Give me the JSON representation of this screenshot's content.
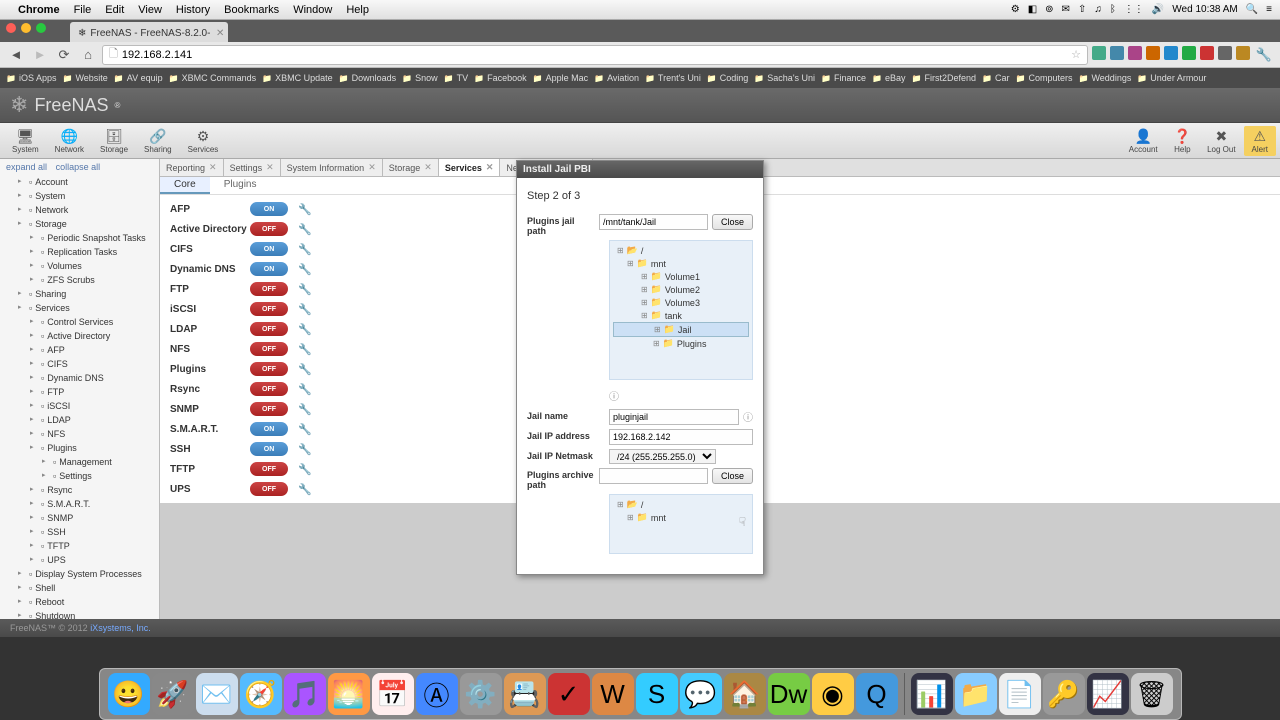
{
  "mac_menu": {
    "app": "Chrome",
    "items": [
      "File",
      "Edit",
      "View",
      "History",
      "Bookmarks",
      "Window",
      "Help"
    ],
    "right_time": "Wed 10:38 AM"
  },
  "browser": {
    "tab_title": "FreeNAS - FreeNAS-8.2.0-",
    "url": "192.168.2.141",
    "bookmarks": [
      "iOS Apps",
      "Website",
      "AV equip",
      "XBMC Commands",
      "XBMC Update",
      "Downloads",
      "Snow",
      "TV",
      "Facebook",
      "Apple Mac",
      "Aviation",
      "Trent's Uni",
      "Coding",
      "Sacha's Uni",
      "Finance",
      "eBay",
      "First2Defend",
      "Car",
      "Computers",
      "Weddings",
      "Under Armour"
    ]
  },
  "freenas": {
    "logo": "FreeNAS",
    "toolbar": {
      "left": [
        "System",
        "Network",
        "Storage",
        "Sharing",
        "Services"
      ],
      "right": [
        "Account",
        "Help",
        "Log Out",
        "Alert"
      ]
    },
    "sidebar": {
      "expand": "expand all",
      "collapse": "collapse all",
      "items": [
        {
          "l": 1,
          "t": "Account"
        },
        {
          "l": 1,
          "t": "System"
        },
        {
          "l": 1,
          "t": "Network"
        },
        {
          "l": 1,
          "t": "Storage"
        },
        {
          "l": 2,
          "t": "Periodic Snapshot Tasks"
        },
        {
          "l": 2,
          "t": "Replication Tasks"
        },
        {
          "l": 2,
          "t": "Volumes"
        },
        {
          "l": 2,
          "t": "ZFS Scrubs"
        },
        {
          "l": 1,
          "t": "Sharing"
        },
        {
          "l": 1,
          "t": "Services"
        },
        {
          "l": 2,
          "t": "Control Services"
        },
        {
          "l": 2,
          "t": "Active Directory"
        },
        {
          "l": 2,
          "t": "AFP"
        },
        {
          "l": 2,
          "t": "CIFS"
        },
        {
          "l": 2,
          "t": "Dynamic DNS"
        },
        {
          "l": 2,
          "t": "FTP"
        },
        {
          "l": 2,
          "t": "iSCSI"
        },
        {
          "l": 2,
          "t": "LDAP"
        },
        {
          "l": 2,
          "t": "NFS"
        },
        {
          "l": 2,
          "t": "Plugins"
        },
        {
          "l": 3,
          "t": "Management"
        },
        {
          "l": 3,
          "t": "Settings"
        },
        {
          "l": 2,
          "t": "Rsync"
        },
        {
          "l": 2,
          "t": "S.M.A.R.T."
        },
        {
          "l": 2,
          "t": "SNMP"
        },
        {
          "l": 2,
          "t": "SSH"
        },
        {
          "l": 2,
          "t": "TFTP"
        },
        {
          "l": 2,
          "t": "UPS"
        },
        {
          "l": 1,
          "t": "Display System Processes"
        },
        {
          "l": 1,
          "t": "Shell"
        },
        {
          "l": 1,
          "t": "Reboot"
        },
        {
          "l": 1,
          "t": "Shutdown"
        }
      ]
    },
    "tabs": [
      "Reporting",
      "Settings",
      "System Information",
      "Storage",
      "Services",
      "Network Settings"
    ],
    "active_tab": "Services",
    "subtabs": [
      "Core",
      "Plugins"
    ],
    "active_subtab": "Core",
    "services": [
      {
        "name": "AFP",
        "on": true
      },
      {
        "name": "Active Directory",
        "on": false
      },
      {
        "name": "CIFS",
        "on": true
      },
      {
        "name": "Dynamic DNS",
        "on": true
      },
      {
        "name": "FTP",
        "on": false
      },
      {
        "name": "iSCSI",
        "on": false
      },
      {
        "name": "LDAP",
        "on": false
      },
      {
        "name": "NFS",
        "on": false
      },
      {
        "name": "Plugins",
        "on": false
      },
      {
        "name": "Rsync",
        "on": false
      },
      {
        "name": "SNMP",
        "on": false
      },
      {
        "name": "S.M.A.R.T.",
        "on": true
      },
      {
        "name": "SSH",
        "on": true
      },
      {
        "name": "TFTP",
        "on": false
      },
      {
        "name": "UPS",
        "on": false
      }
    ],
    "footer": {
      "copyright": "FreeNAS™ © 2012",
      "link": "iXsystems, Inc."
    }
  },
  "modal": {
    "title": "Install Jail PBI",
    "step": "Step 2 of 3",
    "labels": {
      "jail_path": "Plugins jail path",
      "jail_name": "Jail name",
      "jail_ip": "Jail IP address",
      "jail_netmask": "Jail IP Netmask",
      "archive_path": "Plugins archive path",
      "close": "Close"
    },
    "values": {
      "jail_path": "/mnt/tank/Jail",
      "jail_name": "pluginjail",
      "jail_ip": "192.168.2.142",
      "jail_netmask": "/24 (255.255.255.0)",
      "archive_path": ""
    },
    "tree1": {
      "root": "/",
      "nodes": [
        {
          "l": 1,
          "t": "mnt"
        },
        {
          "l": 2,
          "t": "Volume1"
        },
        {
          "l": 2,
          "t": "Volume2"
        },
        {
          "l": 2,
          "t": "Volume3"
        },
        {
          "l": 2,
          "t": "tank"
        },
        {
          "l": 3,
          "t": "Jail",
          "sel": true
        },
        {
          "l": 3,
          "t": "Plugins"
        }
      ]
    },
    "tree2": {
      "root": "/",
      "nodes": [
        {
          "l": 1,
          "t": "mnt"
        }
      ]
    }
  },
  "dock": {
    "icons": [
      "finder",
      "launchpad",
      "mail",
      "safari",
      "itunes",
      "iphoto",
      "calendar",
      "appstore",
      "sysprefs",
      "contacts",
      "things",
      "wunderlist",
      "skype",
      "messages",
      "home",
      "dreamweaver",
      "chrome",
      "quicktime"
    ],
    "right_icons": [
      "activity",
      "folder",
      "textedit",
      "keychain",
      "monitor",
      "trash"
    ]
  }
}
